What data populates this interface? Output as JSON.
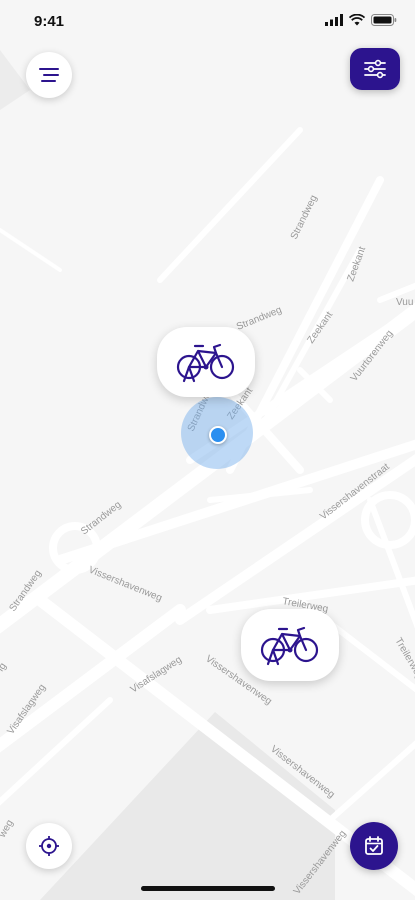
{
  "status": {
    "time": "9:41",
    "icons": [
      "signal-icon",
      "wifi-icon",
      "battery-icon"
    ]
  },
  "colors": {
    "accent": "#2c148e",
    "location": "#2b8ff0",
    "map_bg": "#f6f6f6",
    "road": "#ffffff"
  },
  "buttons": {
    "menu": "menu-icon",
    "filter": "sliders-icon",
    "recenter": "crosshair-icon",
    "calendar": "calendar-check-icon"
  },
  "markers": [
    {
      "type": "bike",
      "icon": "bicycle-icon"
    },
    {
      "type": "bike",
      "icon": "bicycle-icon"
    }
  ],
  "streets": {
    "s1": "Strandweg",
    "s2": "Strandweg",
    "s3": "Strandweg",
    "s4": "Strandweg",
    "s5": "Strandweg",
    "z1": "Zeekant",
    "z2": "Zeekant",
    "z3": "Zeekant",
    "vuurtoren": "Vuurtorenweg",
    "vuu": "Vuu",
    "vhstraat": "Vissershavenstraat",
    "vhweg1": "Vissershavenweg",
    "vhweg2": "Vissershavenweg",
    "vhweg3": "Vissershavenweg",
    "vhweg4": "Vissershavenweg",
    "visafslag1": "Visafslagweg",
    "visafslag2": "Visafslagweg",
    "treilerweg1": "Treilerweg",
    "treilerweg2": "Treilerweg",
    "weg": "weg",
    "ig": "ig"
  }
}
